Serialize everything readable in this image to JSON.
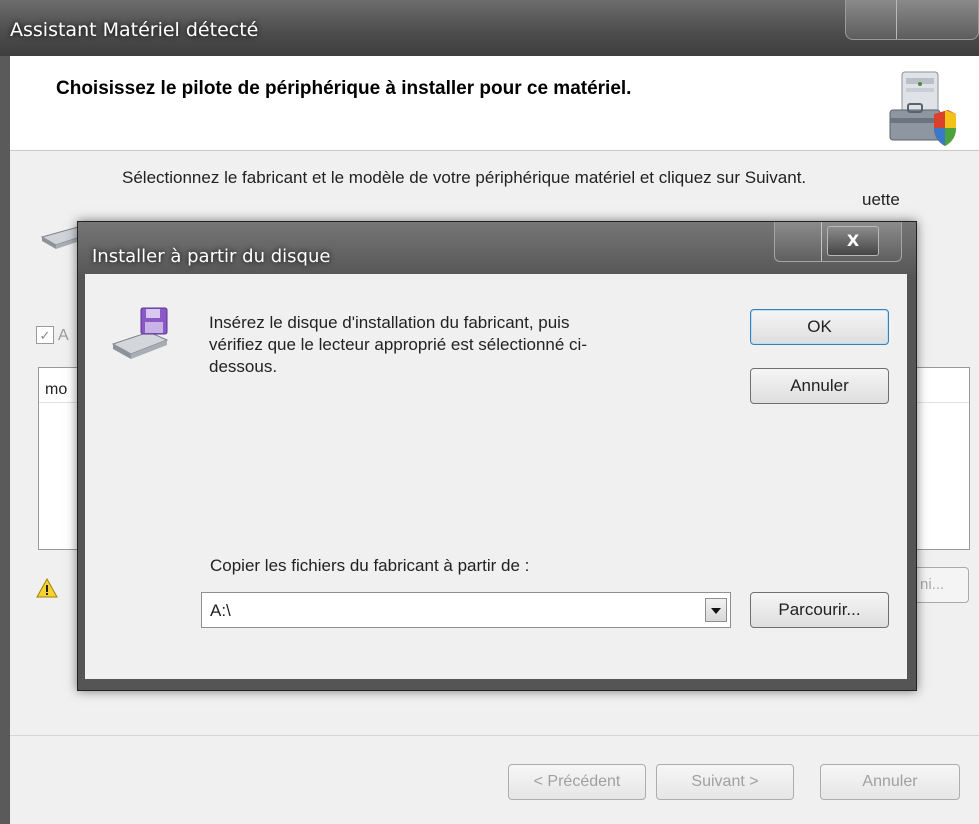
{
  "wizard": {
    "title": "Assistant Matériel détecté",
    "heading": "Choisissez le pilote de périphérique à installer pour ce matériel.",
    "instruction_line1": "Sélectionnez le fabricant et le modèle de votre périphérique matériel et cliquez sur Suivant.",
    "instruction_line2_tail": "uette",
    "checkbox_label_fragment": "A",
    "list_header_fragment": "mo",
    "disk_button_fragment": "ni...",
    "buttons": {
      "prev": "< Précédent",
      "next": "Suivant >",
      "cancel": "Annuler"
    }
  },
  "dialog": {
    "title": "Installer à partir du disque",
    "close_glyph": "X",
    "message": "Insérez le disque d'installation du fabricant, puis vérifiez que le lecteur approprié est sélectionné ci-dessous.",
    "ok_label": "OK",
    "cancel_label": "Annuler",
    "copy_label": "Copier les fichiers du fabricant à partir de :",
    "path_value": "A:\\",
    "browse_label": "Parcourir..."
  },
  "icons": {
    "hardware": "hardware-toolbox-icon",
    "disk": "disk-drive-icon",
    "floppy": "floppy-install-icon",
    "warning": "warning-icon"
  },
  "colors": {
    "titlebar": "#4c4c4c",
    "client_bg": "#f0f0f0",
    "default_button_border": "#3c7fb1"
  }
}
